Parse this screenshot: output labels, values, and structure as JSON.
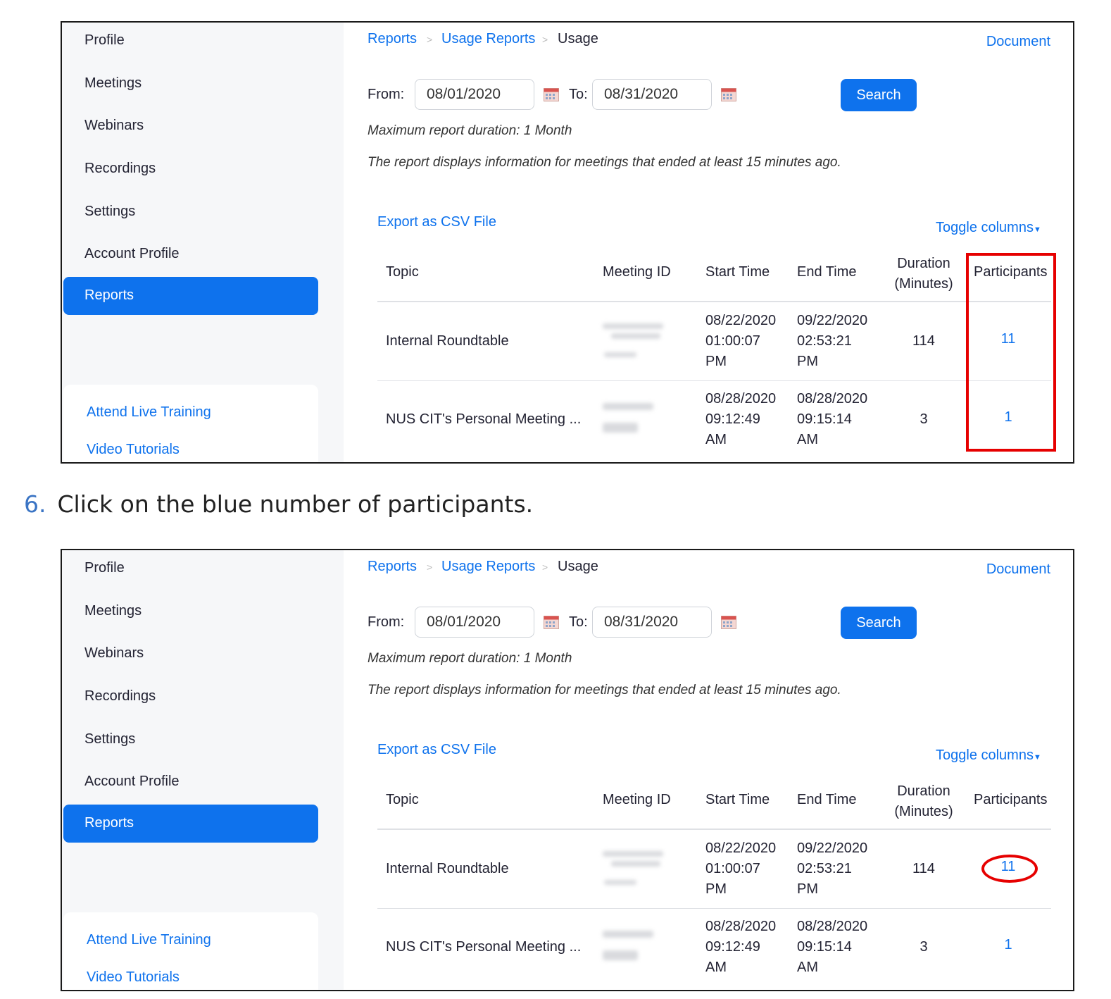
{
  "sidebar": {
    "items": [
      "Profile",
      "Meetings",
      "Webinars",
      "Recordings",
      "Settings",
      "Account Profile"
    ],
    "active": "Reports",
    "links": [
      "Attend Live Training",
      "Video Tutorials"
    ]
  },
  "breadcrumb": {
    "root": "Reports",
    "parent": "Usage Reports",
    "current": "Usage"
  },
  "document_link": "Document",
  "filter": {
    "from_label": "From:",
    "from_value": "08/01/2020",
    "to_label": "To:",
    "to_value": "08/31/2020",
    "search_label": "Search"
  },
  "notes": {
    "max_duration": "Maximum report duration: 1 Month",
    "info": "The report displays information for meetings that ended at least 15 minutes ago."
  },
  "export_label": "Export as CSV File",
  "toggle_label": "Toggle columns",
  "table": {
    "headers": {
      "topic": "Topic",
      "meeting_id": "Meeting ID",
      "start": "Start Time",
      "end": "End Time",
      "duration_1": "Duration",
      "duration_2": "(Minutes)",
      "participants": "Participants"
    },
    "rows": [
      {
        "topic": "Internal Roundtable",
        "start": [
          "08/22/2020",
          "01:00:07",
          "PM"
        ],
        "end": [
          "09/22/2020",
          "02:53:21",
          "PM"
        ],
        "duration": "114",
        "participants": "11"
      },
      {
        "topic": "NUS CIT's Personal Meeting ...",
        "start": [
          "08/28/2020",
          "09:12:49",
          "AM"
        ],
        "end": [
          "08/28/2020",
          "09:15:14",
          "AM"
        ],
        "duration": "3",
        "participants": "1"
      }
    ]
  },
  "step": {
    "number": "6.",
    "text": "Click on the blue number of participants."
  },
  "colors": {
    "accent": "#0e72ed",
    "highlight": "#e60000"
  }
}
